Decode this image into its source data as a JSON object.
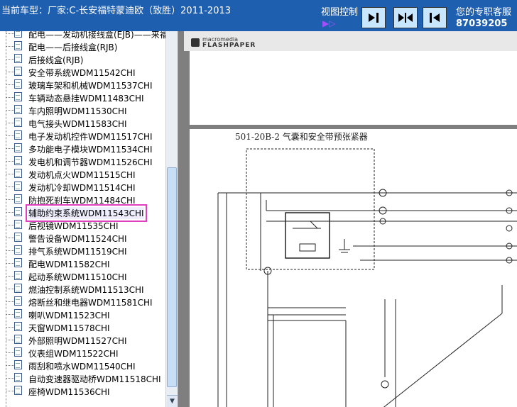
{
  "header": {
    "title": "当前车型：厂家:C-长安福特蒙迪欧（致胜）2011-2013",
    "view_control_label": "视图控制",
    "contact_line1": "您的专职客服",
    "contact_phone": "87039205"
  },
  "sidebar": {
    "items": [
      {
        "label": "配电——发动机接线盒(EJB)——来福"
      },
      {
        "label": "配电——后接线盒(RJB)"
      },
      {
        "label": "后接线盒(RJB)"
      },
      {
        "label": "安全带系统WDM11542CHI"
      },
      {
        "label": "玻璃车架和机械WDM11537CHI"
      },
      {
        "label": "车辆动态悬挂WDM11483CHI"
      },
      {
        "label": "车内照明WDM11530CHI"
      },
      {
        "label": "电气接头WDM11583CHI"
      },
      {
        "label": "电子发动机控件WDM11517CHI"
      },
      {
        "label": "多功能电子模块WDM11534CHI"
      },
      {
        "label": "发电机和调节器WDM11526CHI"
      },
      {
        "label": "发动机点火WDM11515CHI"
      },
      {
        "label": "发动机冷却WDM11514CHI"
      },
      {
        "label": "防抱死刹车WDM11484CHI"
      },
      {
        "label": "辅助约束系统WDM11543CHI",
        "selected": true
      },
      {
        "label": "后视镜WDM11535CHI"
      },
      {
        "label": "警告设备WDM11524CHI"
      },
      {
        "label": "排气系统WDM11519CHI"
      },
      {
        "label": "配电WDM11582CHI"
      },
      {
        "label": "起动系统WDM11510CHI"
      },
      {
        "label": "燃油控制系统WDM11513CHI"
      },
      {
        "label": "熔断丝和继电器WDM11581CHI"
      },
      {
        "label": "喇叭WDM11523CHI"
      },
      {
        "label": "天窗WDM11578CHI"
      },
      {
        "label": "外部照明WDM11527CHI"
      },
      {
        "label": "仪表组WDM11522CHI"
      },
      {
        "label": "雨刮和喷水WDM11540CHI"
      },
      {
        "label": "自动变速器驱动桥WDM11518CHI"
      },
      {
        "label": "座椅WDM11536CHI"
      }
    ]
  },
  "viewer": {
    "logo_small": "macromedia",
    "logo_big": "FLASHPAPER",
    "diagram_title": "501-20B-2 气囊和安全带预张紧器"
  }
}
